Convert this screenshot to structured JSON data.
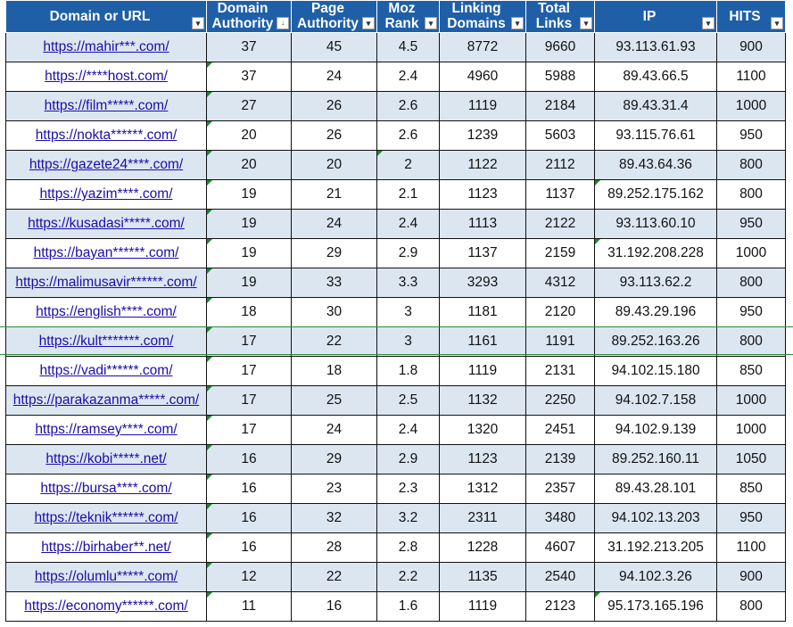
{
  "headers": [
    {
      "label": "Domain or URL",
      "filter_symbol": "▾"
    },
    {
      "label": "Domain Authority",
      "filter_symbol": "↓"
    },
    {
      "label": "Page Authority",
      "filter_symbol": "▾"
    },
    {
      "label": "Moz Rank",
      "filter_symbol": "▾"
    },
    {
      "label": "Linking Domains",
      "filter_symbol": "▾"
    },
    {
      "label": "Total Links",
      "filter_symbol": "▾"
    },
    {
      "label": "IP",
      "filter_symbol": "▾"
    },
    {
      "label": "HITS",
      "filter_symbol": "▾"
    }
  ],
  "rows": [
    {
      "url": "https://mahir***.com/",
      "da": "37",
      "pa": "45",
      "mr": "4.5",
      "ld": "8772",
      "tl": "9660",
      "ip": "93.113.61.93",
      "hits": "900"
    },
    {
      "url": "https://****host.com/",
      "da": "37",
      "pa": "24",
      "mr": "2.4",
      "ld": "4960",
      "tl": "5988",
      "ip": "89.43.66.5",
      "hits": "1100"
    },
    {
      "url": "https://film*****.com/",
      "da": "27",
      "pa": "26",
      "mr": "2.6",
      "ld": "1119",
      "tl": "2184",
      "ip": "89.43.31.4",
      "hits": "1000"
    },
    {
      "url": "https://nokta******.com/",
      "da": "20",
      "pa": "26",
      "mr": "2.6",
      "ld": "1239",
      "tl": "5603",
      "ip": "93.115.76.61",
      "hits": "950"
    },
    {
      "url": "https://gazete24****.com/",
      "da": "20",
      "pa": "20",
      "mr": "2",
      "ld": "1122",
      "tl": "2112",
      "ip": "89.43.64.36",
      "hits": "800"
    },
    {
      "url": "https://yazim****.com/",
      "da": "19",
      "pa": "21",
      "mr": "2.1",
      "ld": "1123",
      "tl": "1137",
      "ip": "89.252.175.162",
      "hits": "800"
    },
    {
      "url": "https://kusadasi*****.com/",
      "da": "19",
      "pa": "24",
      "mr": "2.4",
      "ld": "1113",
      "tl": "2122",
      "ip": "93.113.60.10",
      "hits": "950"
    },
    {
      "url": "https://bayan******.com/",
      "da": "19",
      "pa": "29",
      "mr": "2.9",
      "ld": "1137",
      "tl": "2159",
      "ip": "31.192.208.228",
      "hits": "1000"
    },
    {
      "url": "https://malimusavir******.com/",
      "da": "19",
      "pa": "33",
      "mr": "3.3",
      "ld": "3293",
      "tl": "4312",
      "ip": "93.113.62.2",
      "hits": "800"
    },
    {
      "url": "https://english****.com/",
      "da": "18",
      "pa": "30",
      "mr": "3",
      "ld": "1181",
      "tl": "2120",
      "ip": "89.43.29.196",
      "hits": "950"
    },
    {
      "url": "https://kult*******.com/",
      "da": "17",
      "pa": "22",
      "mr": "3",
      "ld": "1161",
      "tl": "1191",
      "ip": "89.252.163.26",
      "hits": "800"
    },
    {
      "url": "https://vadi******.com/",
      "da": "17",
      "pa": "18",
      "mr": "1.8",
      "ld": "1119",
      "tl": "2131",
      "ip": "94.102.15.180",
      "hits": "850"
    },
    {
      "url": "https://parakazanma*****.com/",
      "da": "17",
      "pa": "25",
      "mr": "2.5",
      "ld": "1132",
      "tl": "2250",
      "ip": "94.102.7.158",
      "hits": "1000"
    },
    {
      "url": "https://ramsey****.com/",
      "da": "17",
      "pa": "24",
      "mr": "2.4",
      "ld": "1320",
      "tl": "2451",
      "ip": "94.102.9.139",
      "hits": "1000"
    },
    {
      "url": "https://kobi*****.net/",
      "da": "16",
      "pa": "29",
      "mr": "2.9",
      "ld": "1123",
      "tl": "2139",
      "ip": "89.252.160.11",
      "hits": "1050"
    },
    {
      "url": "https://bursa****.com/",
      "da": "16",
      "pa": "23",
      "mr": "2.3",
      "ld": "1312",
      "tl": "2357",
      "ip": "89.43.28.101",
      "hits": "850"
    },
    {
      "url": "https://teknik******.com/",
      "da": "16",
      "pa": "32",
      "mr": "3.2",
      "ld": "2311",
      "tl": "3480",
      "ip": "94.102.13.203",
      "hits": "950"
    },
    {
      "url": "https://birhaber**.net/",
      "da": "16",
      "pa": "28",
      "mr": "2.8",
      "ld": "1228",
      "tl": "4607",
      "ip": "31.192.213.205",
      "hits": "1100"
    },
    {
      "url": "https://olumlu*****.com/",
      "da": "12",
      "pa": "22",
      "mr": "2.2",
      "ld": "1135",
      "tl": "2540",
      "ip": "94.102.3.26",
      "hits": "900"
    },
    {
      "url": "https://economy******.com/",
      "da": "11",
      "pa": "16",
      "mr": "1.6",
      "ld": "1119",
      "tl": "2123",
      "ip": "95.173.165.196",
      "hits": "800"
    }
  ]
}
